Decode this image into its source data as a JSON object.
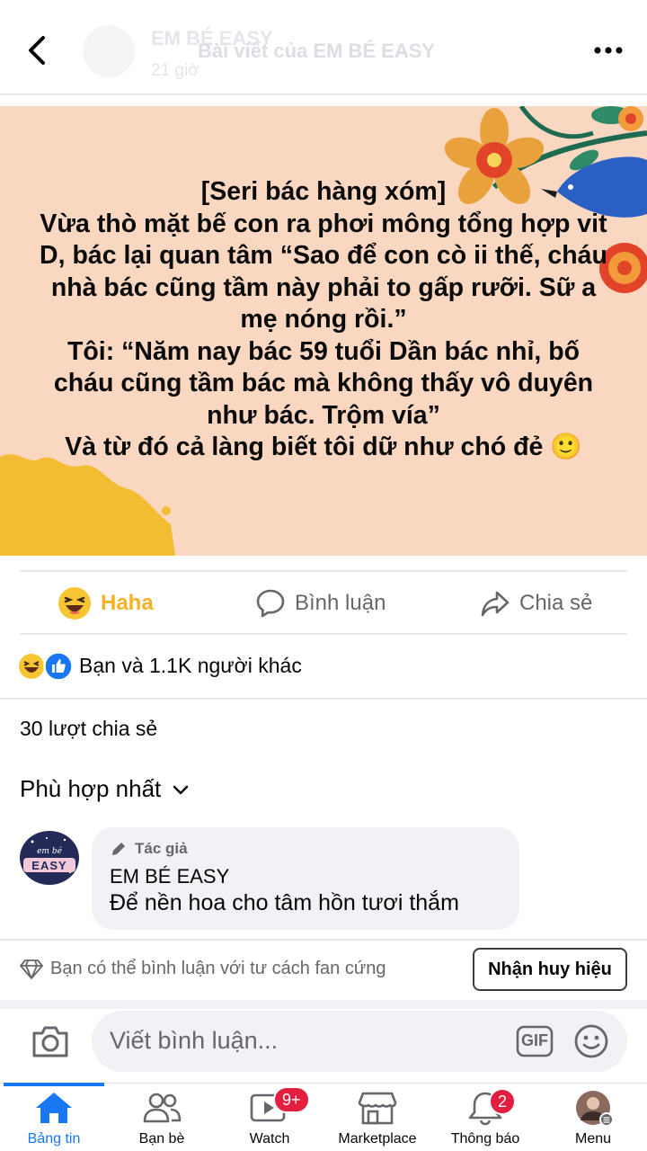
{
  "header": {
    "page_name": "EM BÉ EASY",
    "post_time": "21 giờ",
    "title": "Bài viết của EM BÉ EASY"
  },
  "post": {
    "text": "[Seri bác hàng xóm]\nVừa thò mặt bế con ra phơi mông tổng hợp vit D, bác lại quan tâm “Sao để con cò ii thế, cháu nhà bác cũng tầm này phải to gấp rưỡi. Sữ a mẹ nóng rồi.”\nTôi: “Năm nay bác 59 tuổi Dần bác nhỉ, bố cháu cũng tầm bác mà không thấy vô duyên như bác. Trộm vía”\nVà từ đó cả làng biết tôi dữ như chó đẻ 🙂",
    "background_color": "#fad7c1"
  },
  "actions": {
    "haha_label": "Haha",
    "comment_label": "Bình luận",
    "share_label": "Chia sẻ"
  },
  "reactions": {
    "summary": "Bạn và 1.1K người khác",
    "icons": [
      "haha-icon",
      "like-icon"
    ]
  },
  "shares_count": "30 lượt chia sẻ",
  "sort_label": "Phù hợp nhất",
  "comment": {
    "author_tag": "Tác giả",
    "author_name": "EM BÉ EASY",
    "text": "Để nền hoa cho tâm hồn tươi thắm",
    "avatar_text": "EASY"
  },
  "fan_bar": {
    "text": "Bạn có thể bình luận với tư cách fan cứng",
    "button_label": "Nhận huy hiệu"
  },
  "composer": {
    "placeholder": "Viết bình luận...",
    "gif_label": "GIF"
  },
  "tabs": [
    {
      "label": "Bảng tin",
      "icon": "home-icon",
      "active": true
    },
    {
      "label": "Bạn bè",
      "icon": "friends-icon"
    },
    {
      "label": "Watch",
      "icon": "watch-icon",
      "badge": "9+"
    },
    {
      "label": "Marketplace",
      "icon": "marketplace-icon"
    },
    {
      "label": "Thông báo",
      "icon": "bell-icon",
      "badge": "2"
    },
    {
      "label": "Menu",
      "icon": "profile-avatar"
    }
  ],
  "colors": {
    "accent": "#1877f2",
    "haha": "#f7b125",
    "badge": "#e41e3f"
  }
}
